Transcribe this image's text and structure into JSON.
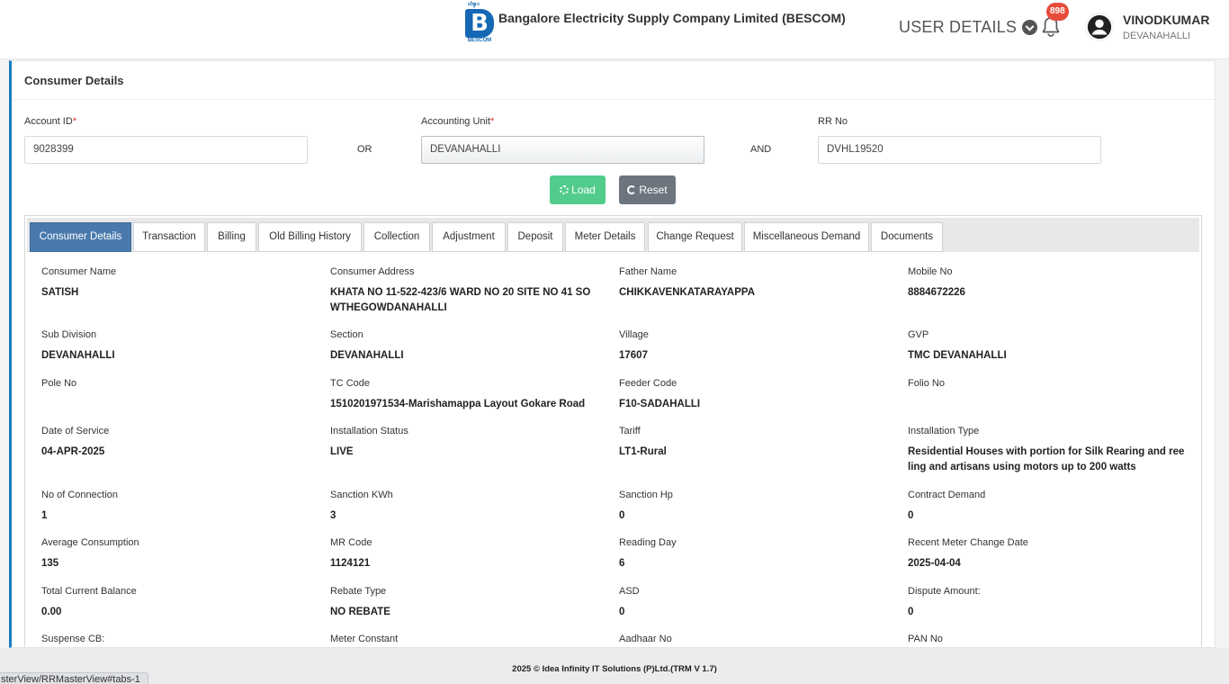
{
  "header": {
    "logo_top_text": "ಬೆಸ್ಕಾಂ",
    "logo_letter": "B",
    "logo_bottom_text": "BESCOM",
    "company_name": "Bangalore Electricity Supply Company Limited (BESCOM)",
    "user_details_label": "USER DETAILS",
    "notification_count": "898",
    "user_name": "VINODKUMAR",
    "user_location": "DEVANAHALLI"
  },
  "card": {
    "title": "Consumer Details",
    "account_id_label": "Account ID",
    "account_id_value": "9028399",
    "or_label": "OR",
    "accounting_unit_label": "Accounting Unit",
    "accounting_unit_value": "DEVANAHALLI",
    "and_label": "AND",
    "rr_no_label": "RR No",
    "rr_no_value": "DVHL19520",
    "required_mark": "*",
    "load_label": "Load",
    "reset_label": "Reset"
  },
  "tabs": [
    {
      "label": "Consumer Details",
      "active": true
    },
    {
      "label": "Transaction"
    },
    {
      "label": "Billing"
    },
    {
      "label": "Old Billing History"
    },
    {
      "label": "Collection"
    },
    {
      "label": "Adjustment"
    },
    {
      "label": "Deposit"
    },
    {
      "label": "Meter Details"
    },
    {
      "label": "Change Request"
    },
    {
      "label": "Miscellaneous Demand"
    },
    {
      "label": "Documents"
    }
  ],
  "details": [
    {
      "label": "Consumer Name",
      "value": "SATISH"
    },
    {
      "label": "Consumer Address",
      "value": "KHATA NO 11-522-423/6 WARD NO 20 SITE NO 41 SOWTHEGOWDANAHALLI"
    },
    {
      "label": "Father Name",
      "value": "CHIKKAVENKATARAYAPPA"
    },
    {
      "label": "Mobile No",
      "value": "8884672226"
    },
    {
      "label": "Sub Division",
      "value": "DEVANAHALLI"
    },
    {
      "label": "Section",
      "value": "DEVANAHALLI"
    },
    {
      "label": "Village",
      "value": "17607"
    },
    {
      "label": "GVP",
      "value": "TMC DEVANAHALLI"
    },
    {
      "label": "Pole No",
      "value": ""
    },
    {
      "label": "TC Code",
      "value": "1510201971534-Marishamappa Layout Gokare Road"
    },
    {
      "label": "Feeder Code",
      "value": "F10-SADAHALLI"
    },
    {
      "label": "Folio No",
      "value": ""
    },
    {
      "label": "Date of Service",
      "value": "04-APR-2025"
    },
    {
      "label": "Installation Status",
      "value": "LIVE"
    },
    {
      "label": "Tariff",
      "value": "LT1-Rural"
    },
    {
      "label": "Installation Type",
      "value": "Residential Houses with portion for Silk Rearing and reeling and artisans using motors up to 200 watts"
    },
    {
      "label": "No of Connection",
      "value": "1"
    },
    {
      "label": "Sanction KWh",
      "value": "3"
    },
    {
      "label": "Sanction Hp",
      "value": "0"
    },
    {
      "label": "Contract Demand",
      "value": "0"
    },
    {
      "label": "Average Consumption",
      "value": "135"
    },
    {
      "label": "MR Code",
      "value": "1124121"
    },
    {
      "label": "Reading Day",
      "value": "6"
    },
    {
      "label": "Recent Meter Change Date",
      "value": "2025-04-04"
    },
    {
      "label": "Total Current Balance",
      "value": "0.00"
    },
    {
      "label": "Rebate Type",
      "value": "NO REBATE"
    },
    {
      "label": "ASD",
      "value": "0"
    },
    {
      "label": "Dispute Amount:",
      "value": "0"
    },
    {
      "label": "Suspense CB:",
      "value": ""
    },
    {
      "label": "Meter Constant",
      "value": ""
    },
    {
      "label": "Aadhaar No",
      "value": ""
    },
    {
      "label": "PAN No",
      "value": ""
    }
  ],
  "footer": {
    "copyright": "2025 © Idea Infinity IT Solutions (P)Ltd.(TRM V 1.7)",
    "status_url": "sterView/RRMasterView#tabs-1"
  },
  "colors": {
    "accent": "#1a7cc1",
    "active_tab": "#4a7aad",
    "load_button": "#52cc8c",
    "reset_button": "#6c757d",
    "badge": "#e74c3c"
  }
}
